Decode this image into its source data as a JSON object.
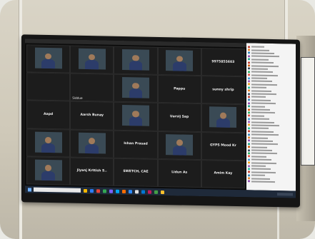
{
  "scene": {
    "description_tags": [
      "wall-mounted-display",
      "video-conference"
    ],
    "colors": {
      "wall": "#d4cfc1",
      "tv_bezel": "#151515",
      "tile_bg": "#1c1c1c",
      "panel_bg": "#f4f4f4",
      "taskbar": "#1f2a3a"
    }
  },
  "meeting": {
    "tiles": [
      {
        "name": "",
        "video": true
      },
      {
        "name": "",
        "video": true
      },
      {
        "name": "",
        "video": true
      },
      {
        "name": "",
        "video": true
      },
      {
        "name": "",
        "video": false,
        "center": "9975855603"
      },
      {
        "name": "",
        "video": false
      },
      {
        "name": "Siddue",
        "video": false
      },
      {
        "name": "",
        "video": true
      },
      {
        "name": "",
        "video": false,
        "center": "Pappu"
      },
      {
        "name": "",
        "video": false,
        "center": "sunny shrip"
      },
      {
        "name": "",
        "video": false,
        "center": "Aapd"
      },
      {
        "name": "",
        "video": false,
        "center": "Aarsh Bunay"
      },
      {
        "name": "",
        "video": true
      },
      {
        "name": "",
        "video": false,
        "center": "Uarsij Sap"
      },
      {
        "name": "",
        "video": true
      },
      {
        "name": "",
        "video": true
      },
      {
        "name": "",
        "video": true
      },
      {
        "name": "",
        "video": false,
        "center": "Ishan Prasad"
      },
      {
        "name": "",
        "video": true
      },
      {
        "name": "",
        "video": false,
        "center": "GYPS Mood Kr"
      },
      {
        "name": "",
        "video": true
      },
      {
        "name": "",
        "video": false,
        "center": "Jiyanj Krttish S.."
      },
      {
        "name": "",
        "video": false,
        "center": "SWETCH, CAE"
      },
      {
        "name": "",
        "video": false,
        "center": "Lidun As"
      },
      {
        "name": "",
        "video": false,
        "center": "Amim Kay"
      }
    ],
    "participant_panel": {
      "rows": [
        {
          "color": "#c0392b"
        },
        {
          "color": "#e67e22"
        },
        {
          "color": "#2980b9"
        },
        {
          "color": "#8e44ad"
        },
        {
          "color": "#16a085"
        },
        {
          "color": "#c0392b"
        },
        {
          "color": "#d35400"
        },
        {
          "color": "#2c3e50"
        },
        {
          "color": "#27ae60"
        },
        {
          "color": "#e74c3c"
        },
        {
          "color": "#3498db"
        },
        {
          "color": "#9b59b6"
        },
        {
          "color": "#f39c12"
        },
        {
          "color": "#1abc9c"
        },
        {
          "color": "#e67e22"
        },
        {
          "color": "#34495e"
        },
        {
          "color": "#c0392b"
        },
        {
          "color": "#2980b9"
        },
        {
          "color": "#8e44ad"
        },
        {
          "color": "#16a085"
        },
        {
          "color": "#d35400"
        },
        {
          "color": "#27ae60"
        },
        {
          "color": "#e74c3c"
        },
        {
          "color": "#3498db"
        },
        {
          "color": "#9b59b6"
        },
        {
          "color": "#f39c12"
        },
        {
          "color": "#1abc9c"
        },
        {
          "color": "#c0392b"
        },
        {
          "color": "#2980b9"
        },
        {
          "color": "#e67e22"
        },
        {
          "color": "#8e44ad"
        },
        {
          "color": "#16a085"
        },
        {
          "color": "#d35400"
        },
        {
          "color": "#34495e"
        },
        {
          "color": "#27ae60"
        },
        {
          "color": "#e74c3c"
        },
        {
          "color": "#3498db"
        },
        {
          "color": "#f39c12"
        },
        {
          "color": "#9b59b6"
        },
        {
          "color": "#1abc9c"
        },
        {
          "color": "#c0392b"
        },
        {
          "color": "#2980b9"
        },
        {
          "color": "#e67e22"
        },
        {
          "color": "#8e44ad"
        }
      ]
    }
  },
  "taskbar": {
    "app_colors": [
      "#f5b700",
      "#2d7df6",
      "#e94235",
      "#34a853",
      "#7b61ff",
      "#00a4ef",
      "#ff6d00",
      "#2d8cff",
      "#e0e0e0",
      "#0078d4",
      "#c2185b",
      "#43a047",
      "#fbc02d"
    ]
  }
}
